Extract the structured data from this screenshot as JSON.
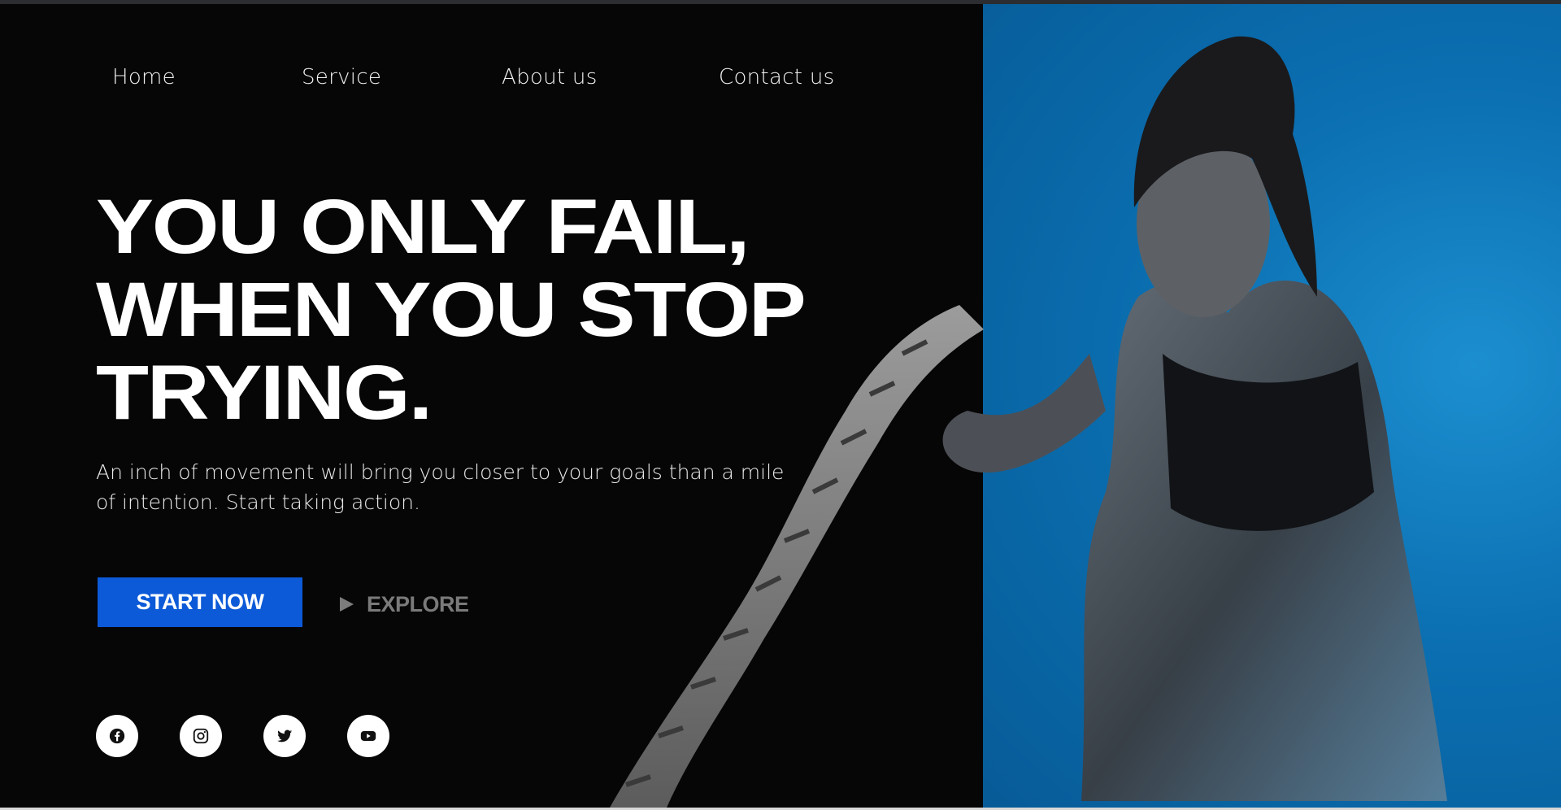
{
  "nav": {
    "items": [
      {
        "label": "Home"
      },
      {
        "label": "Service"
      },
      {
        "label": "About us"
      },
      {
        "label": "Contact us"
      }
    ]
  },
  "hero": {
    "headline_lines": [
      "YOU ONLY FAIL,",
      "WHEN YOU STOP",
      "TRYING."
    ],
    "subtext": "An inch of movement will bring you closer to your goals than a mile of intention. Start taking action.",
    "primary_button": "START NOW",
    "secondary_button": "EXPLORE"
  },
  "social": {
    "icons": [
      "facebook-icon",
      "instagram-icon",
      "twitter-icon",
      "youtube-icon"
    ]
  },
  "colors": {
    "background_dark": "#060606",
    "accent_blue": "#0c5ad8",
    "photo_background_blue": "#0b6fb1",
    "explore_gray": "#7a7a7a"
  }
}
